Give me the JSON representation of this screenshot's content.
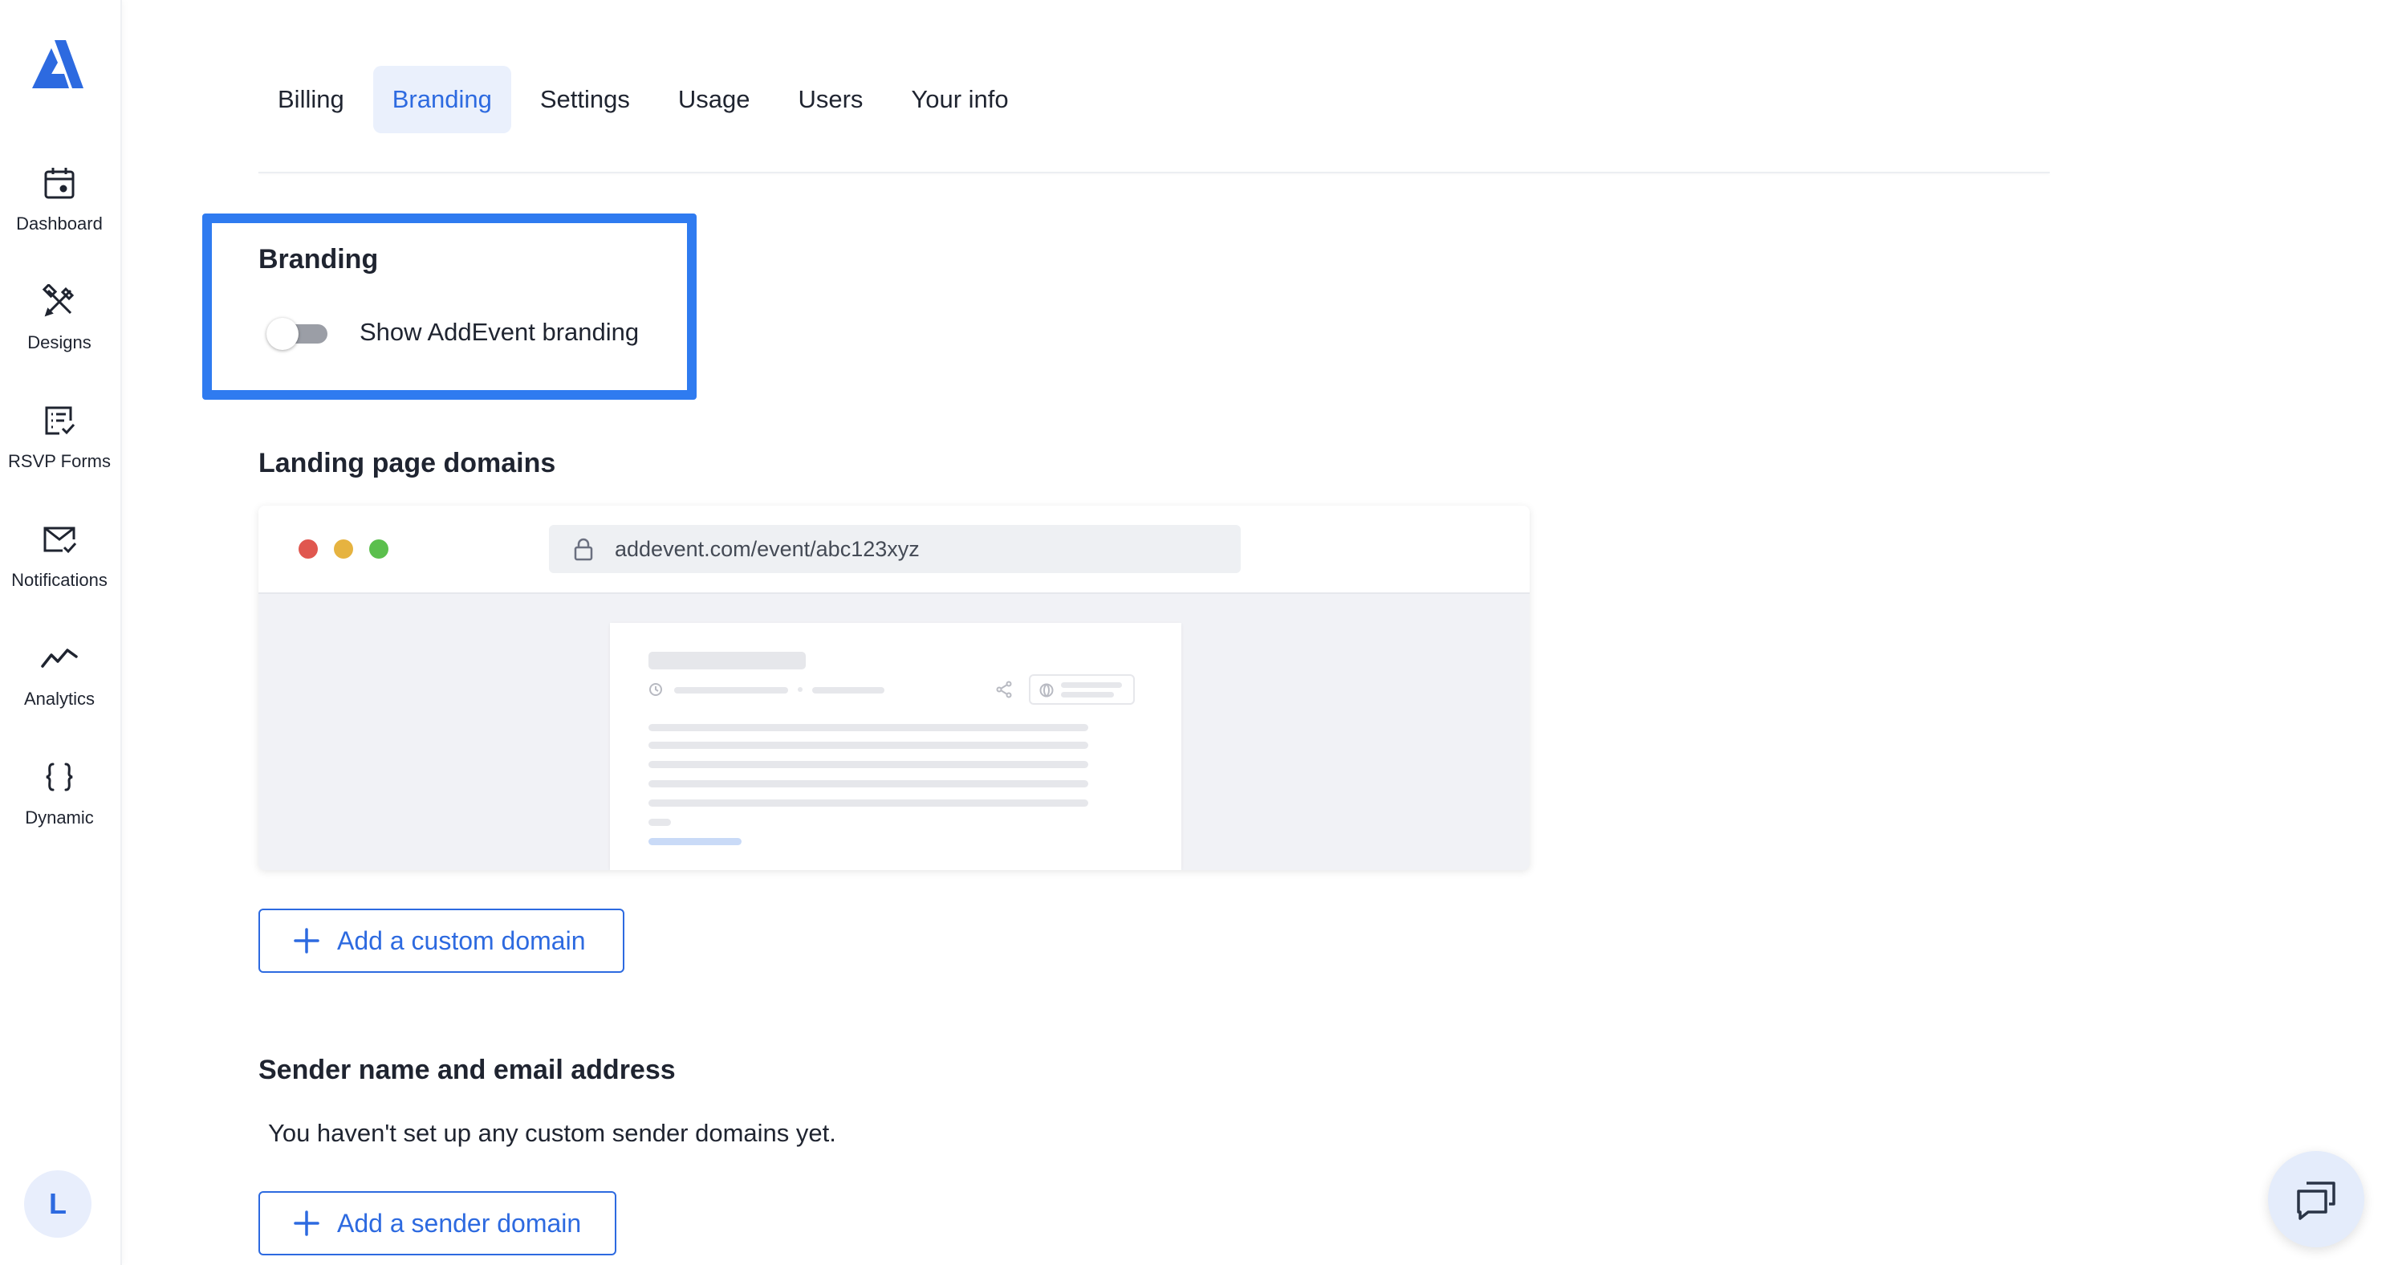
{
  "sidebar": {
    "logo": "addevent-logo",
    "items": [
      {
        "label": "Dashboard",
        "icon": "calendar-icon"
      },
      {
        "label": "Designs",
        "icon": "designs-icon"
      },
      {
        "label": "RSVP Forms",
        "icon": "rsvp-form-icon"
      },
      {
        "label": "Notifications",
        "icon": "envelope-icon"
      },
      {
        "label": "Analytics",
        "icon": "analytics-line-icon"
      },
      {
        "label": "Dynamic",
        "icon": "curly-braces-icon"
      }
    ],
    "avatar_initial": "L"
  },
  "tabs": [
    {
      "label": "Billing",
      "active": false
    },
    {
      "label": "Branding",
      "active": true
    },
    {
      "label": "Settings",
      "active": false
    },
    {
      "label": "Usage",
      "active": false
    },
    {
      "label": "Users",
      "active": false
    },
    {
      "label": "Your info",
      "active": false
    }
  ],
  "branding": {
    "title": "Branding",
    "toggle_label": "Show AddEvent branding",
    "toggle_on": false
  },
  "landing": {
    "title": "Landing page domains",
    "preview_url": "addevent.com/event/abc123xyz",
    "add_button": "Add a custom domain"
  },
  "sender": {
    "title": "Sender name and email address",
    "empty_message": "You haven't set up any custom sender domains yet.",
    "add_button": "Add a sender domain"
  },
  "colors": {
    "accent": "#2d6ae0",
    "highlight_box": "#2f7bf0",
    "dot_red": "#e0574f",
    "dot_yellow": "#e6b340",
    "dot_green": "#5bbf4d"
  }
}
